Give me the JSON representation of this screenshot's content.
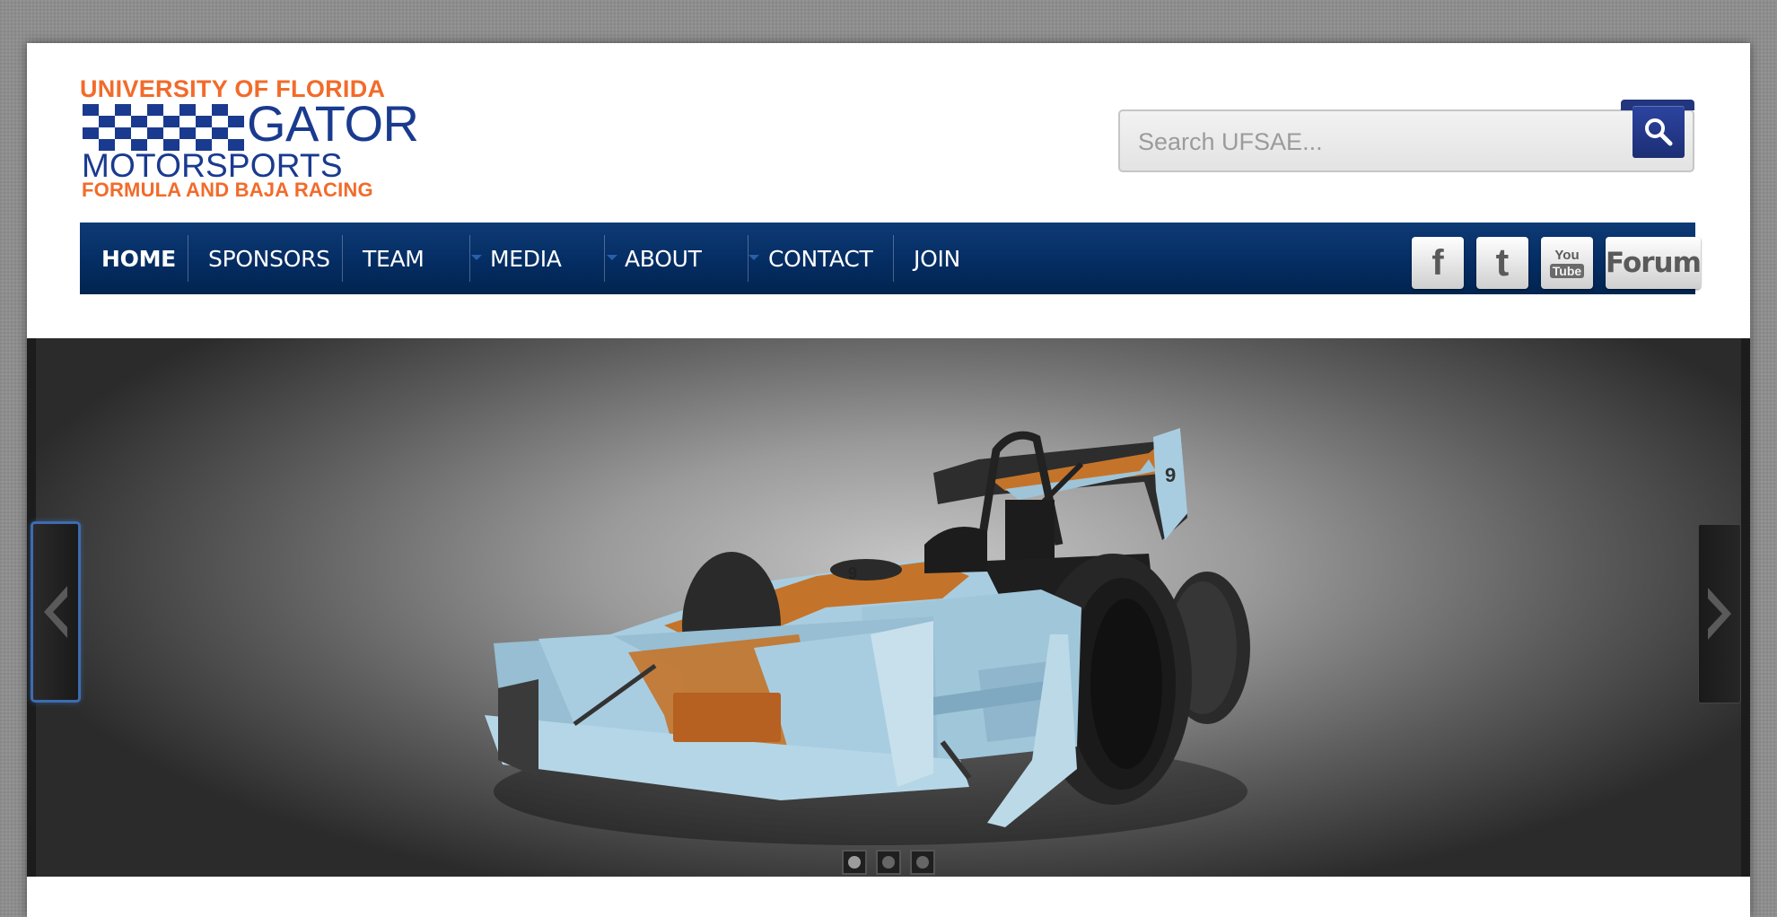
{
  "logo": {
    "line1": "UNIVERSITY OF FLORIDA",
    "line2": "GATOR",
    "line3": "MOTORSPORTS",
    "line4": "FORMULA AND BAJA RACING"
  },
  "search": {
    "placeholder": "Search UFSAE...",
    "value": "",
    "button_icon": "search-icon"
  },
  "nav": {
    "items": [
      {
        "label": "HOME",
        "active": true
      },
      {
        "label": "SPONSORS"
      },
      {
        "label": "TEAM",
        "has_dropdown": true
      },
      {
        "label": "MEDIA",
        "has_dropdown": true
      },
      {
        "label": "ABOUT",
        "has_dropdown": true
      },
      {
        "label": "CONTACT"
      },
      {
        "label": "JOIN"
      }
    ]
  },
  "social": {
    "facebook_label": "f",
    "twitter_label": "t",
    "youtube_label_top": "You",
    "youtube_label_bottom": "Tube",
    "forum_label": "Forum"
  },
  "slider": {
    "slide_count": 3,
    "active_slide": 1,
    "car_number": "9",
    "prev_icon": "chevron-left-icon",
    "next_icon": "chevron-right-icon"
  },
  "colors": {
    "brand_orange": "#f26b2a",
    "brand_blue": "#1a3a8f",
    "nav_blue": "#042d63",
    "car_light_blue": "#a9cde0",
    "car_orange": "#c96a22"
  }
}
